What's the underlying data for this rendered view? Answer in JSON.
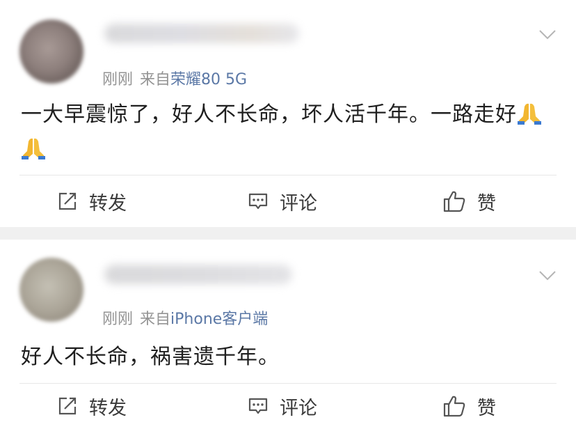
{
  "posts": [
    {
      "time": "刚刚",
      "from_label": "来自",
      "source": "荣耀80 5G",
      "content_text": "一大早震惊了，好人不长命，坏人活千年。一路走好",
      "emoji": [
        "folded-hands",
        "folded-hands"
      ],
      "actions": {
        "repost": "转发",
        "comment": "评论",
        "like": "赞"
      }
    },
    {
      "time": "刚刚",
      "from_label": "来自",
      "source": "iPhone客户端",
      "content_text": "好人不长命，祸害遗千年。",
      "actions": {
        "repost": "转发",
        "comment": "评论",
        "like": "赞"
      }
    }
  ],
  "colors": {
    "source_link": "#5b78a6",
    "meta_gray": "#939393",
    "text": "#1f1f1f",
    "separator": "#f0f0f0"
  }
}
